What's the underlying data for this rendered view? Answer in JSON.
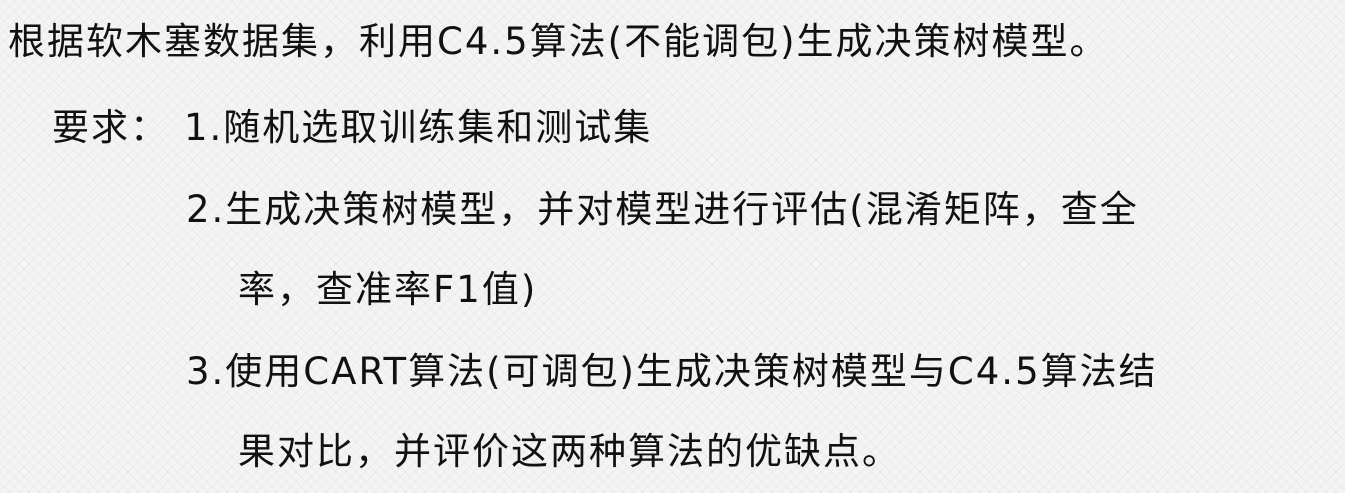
{
  "slide": {
    "title": "根据软木塞数据集，利用C4.5算法(不能调包)生成决策树模型。",
    "requirements_label": "要求：",
    "items": [
      {
        "line1": "1.随机选取训练集和测试集",
        "line2": ""
      },
      {
        "line1": "2.生成决策树模型，并对模型进行评估(混淆矩阵，查全",
        "line2": "率，查准率F1值)"
      },
      {
        "line1": "3.使用CART算法(可调包)生成决策树模型与C4.5算法结",
        "line2": "果对比，并评价这两种算法的优缺点。"
      }
    ]
  }
}
